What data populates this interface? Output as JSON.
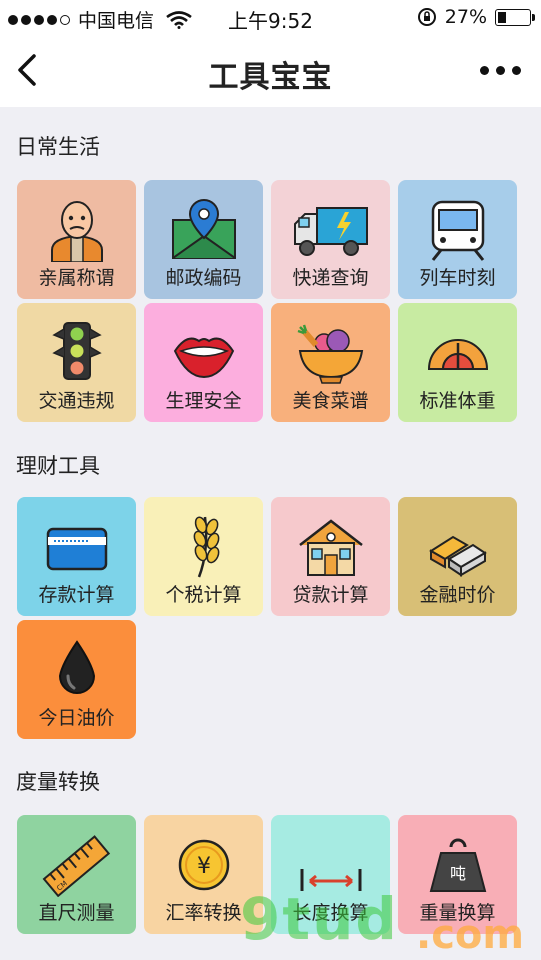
{
  "status": {
    "carrier": "中国电信",
    "time": "上午9:52",
    "battery": "27%",
    "battery_level": 0.27
  },
  "nav": {
    "title": "工具宝宝"
  },
  "sections": [
    {
      "title": "日常生活",
      "items": [
        {
          "label": "亲属称谓",
          "color": "#efbba2",
          "icon": "person-icon"
        },
        {
          "label": "邮政编码",
          "color": "#a8c4e0",
          "icon": "map-pin-icon"
        },
        {
          "label": "快递查询",
          "color": "#f3d2d6",
          "icon": "truck-icon"
        },
        {
          "label": "列车时刻",
          "color": "#a7cdea",
          "icon": "train-icon"
        },
        {
          "label": "交通违规",
          "color": "#f0d9a4",
          "icon": "traffic-light-icon"
        },
        {
          "label": "生理安全",
          "color": "#fcaede",
          "icon": "lips-icon"
        },
        {
          "label": "美食菜谱",
          "color": "#f8b07c",
          "icon": "food-bowl-icon"
        },
        {
          "label": "标准体重",
          "color": "#c8eba2",
          "icon": "scale-icon"
        }
      ]
    },
    {
      "title": "理财工具",
      "items": [
        {
          "label": "存款计算",
          "color": "#7dd3e9",
          "icon": "bank-card-icon"
        },
        {
          "label": "个税计算",
          "color": "#f9f0b8",
          "icon": "wheat-icon"
        },
        {
          "label": "贷款计算",
          "color": "#f6c9cc",
          "icon": "house-icon"
        },
        {
          "label": "金融时价",
          "color": "#d8bf76",
          "icon": "gold-bar-icon"
        },
        {
          "label": "今日油价",
          "color": "#fb8e3c",
          "icon": "oil-drop-icon"
        }
      ]
    },
    {
      "title": "度量转换",
      "items": [
        {
          "label": "直尺测量",
          "color": "#8fd3a0",
          "icon": "ruler-icon"
        },
        {
          "label": "汇率转换",
          "color": "#f8d4a2",
          "icon": "yen-coin-icon"
        },
        {
          "label": "长度换算",
          "color": "#a6ebe2",
          "icon": "length-icon"
        },
        {
          "label": "重量换算",
          "color": "#f8aeb6",
          "icon": "weight-icon",
          "icon_text": "吨"
        }
      ]
    }
  ],
  "watermark": {
    "main": "9tud",
    "suffix": ".com"
  }
}
